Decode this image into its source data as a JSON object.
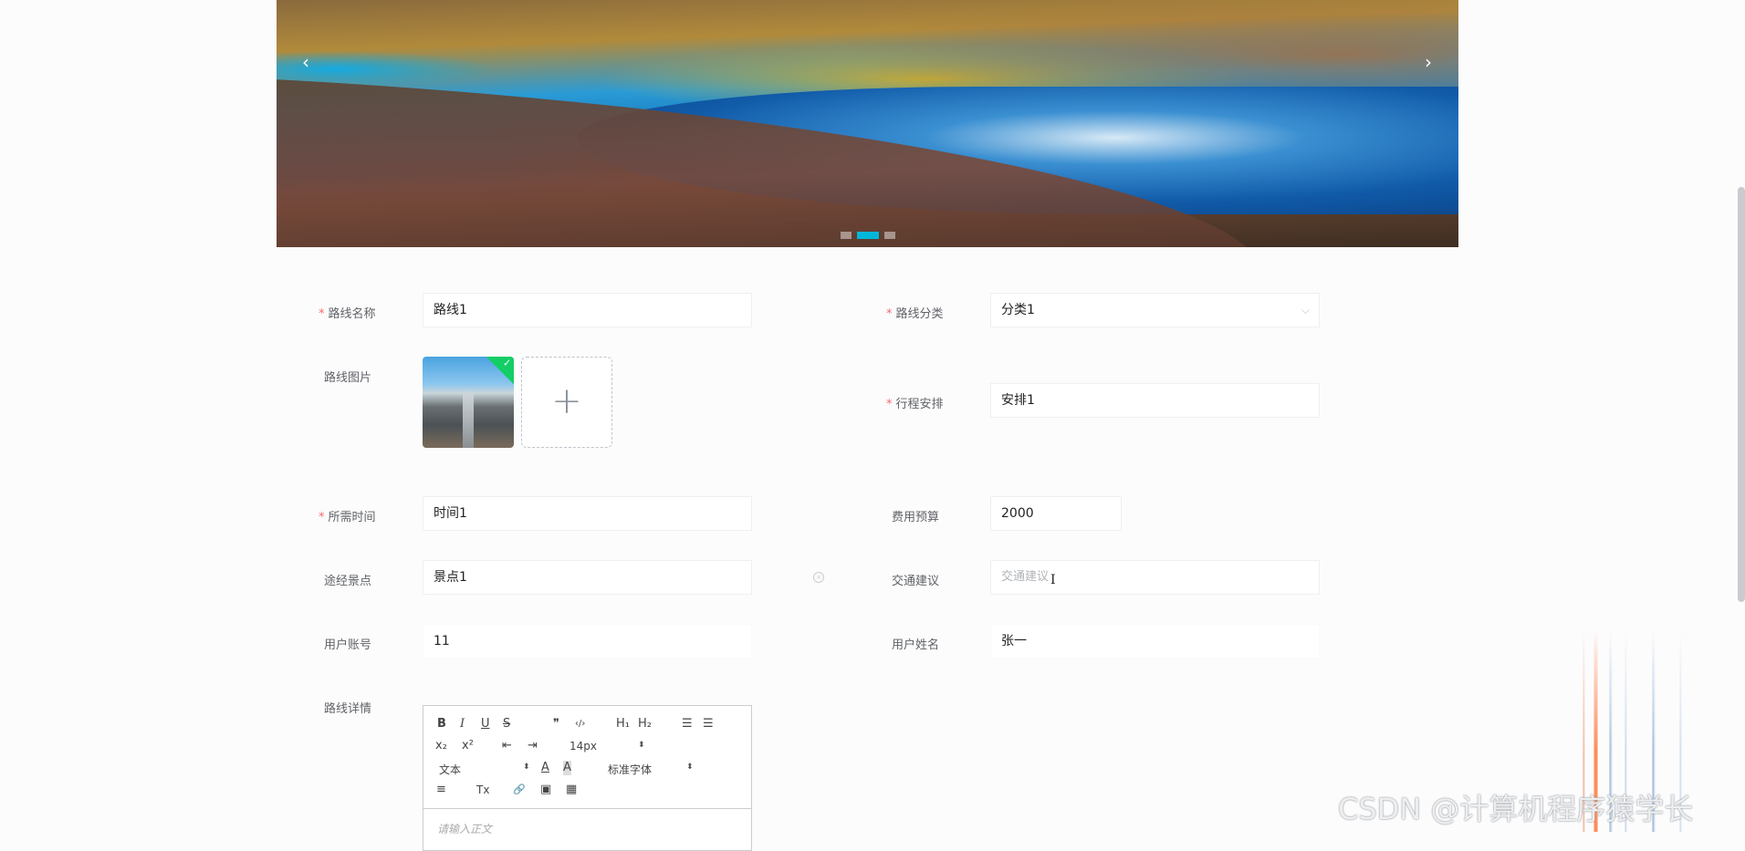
{
  "carousel": {
    "prev_icon": "‹",
    "next_icon": "›",
    "indicator_count": 3,
    "active_index": 1
  },
  "form": {
    "route_name": {
      "label": "路线名称",
      "value": "路线1",
      "required": true
    },
    "route_category": {
      "label": "路线分类",
      "value": "分类1",
      "required": true
    },
    "route_image": {
      "label": "路线图片",
      "add_icon": "+",
      "check_icon": "✓"
    },
    "itinerary": {
      "label": "行程安排",
      "value": "安排1",
      "required": true
    },
    "duration": {
      "label": "所需时间",
      "value": "时间1",
      "required": true
    },
    "budget": {
      "label": "费用预算",
      "value": "2000"
    },
    "spots": {
      "label": "途经景点",
      "value": "景点1"
    },
    "transport": {
      "label": "交通建议",
      "placeholder": "交通建议"
    },
    "account": {
      "label": "用户账号",
      "value": "11"
    },
    "username": {
      "label": "用户姓名",
      "value": "张一"
    },
    "details": {
      "label": "路线详情",
      "placeholder": "请输入正文",
      "toolbar": {
        "bold": "B",
        "italic": "I",
        "underline": "U",
        "strike": "S",
        "quote": "❞",
        "code": "‹/›",
        "h1": "H₁",
        "h2": "H₂",
        "ol": "☰",
        "ul": "☰",
        "sub": "x₂",
        "sup": "x²",
        "outdent": "⇤",
        "indent": "⇥",
        "size": "14px",
        "header": "文本",
        "font": "标准字体",
        "color": "A",
        "background": "A",
        "align": "≡",
        "clean": "Tx",
        "link": "🔗",
        "image": "▣",
        "video": "▦"
      }
    }
  },
  "colors": {
    "required": "#f56c6c",
    "active_indicator": "#00b7d9",
    "success": "#13ce66"
  },
  "watermark": "CSDN @计算机程序猿学长"
}
